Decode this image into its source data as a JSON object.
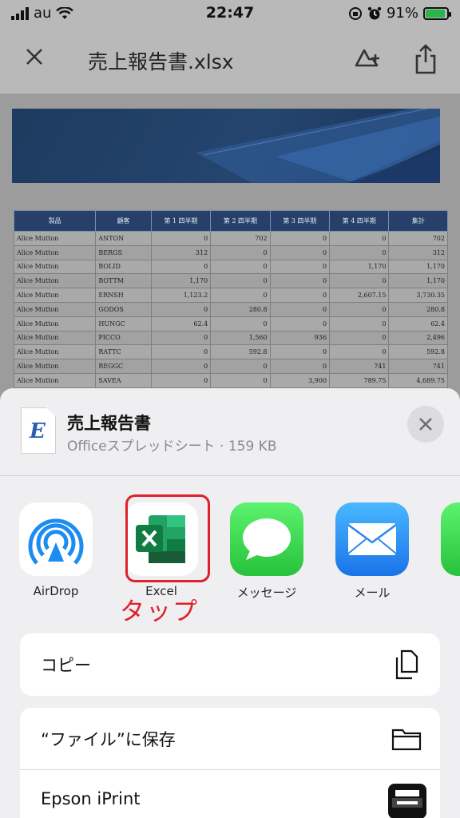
{
  "status": {
    "carrier": "au",
    "time": "22:47",
    "battery": "91%",
    "battery_level": 0.91
  },
  "nav": {
    "title": "売上報告書.xlsx",
    "close_icon": "close-icon",
    "add_cloud_icon": "cloud-add-icon",
    "share_icon": "share-icon"
  },
  "table": {
    "headers": [
      "製品",
      "顧客",
      "第 1 四半期",
      "第 2 四半期",
      "第 3 四半期",
      "第 4 四半期",
      "集計"
    ],
    "rows": [
      [
        "Alice Mutton",
        "ANTON",
        "0",
        "702",
        "0",
        "0",
        "702"
      ],
      [
        "Alice Mutton",
        "BERGS",
        "312",
        "0",
        "0",
        "0",
        "312"
      ],
      [
        "Alice Mutton",
        "BOLID",
        "0",
        "0",
        "0",
        "1,170",
        "1,170"
      ],
      [
        "Alice Mutton",
        "BOTTM",
        "1,170",
        "0",
        "0",
        "0",
        "1,170"
      ],
      [
        "Alice Mutton",
        "ERNSH",
        "1,123.2",
        "0",
        "0",
        "2,607.15",
        "3,730.35"
      ],
      [
        "Alice Mutton",
        "GODOS",
        "0",
        "280.8",
        "0",
        "0",
        "280.8"
      ],
      [
        "Alice Mutton",
        "HUNGC",
        "62.4",
        "0",
        "0",
        "0",
        "62.4"
      ],
      [
        "Alice Mutton",
        "PICCO",
        "0",
        "1,560",
        "936",
        "0",
        "2,496"
      ],
      [
        "Alice Mutton",
        "RATTC",
        "0",
        "592.8",
        "0",
        "0",
        "592.8"
      ],
      [
        "Alice Mutton",
        "REGGC",
        "0",
        "0",
        "0",
        "741",
        "741"
      ],
      [
        "Alice Mutton",
        "SAVEA",
        "0",
        "0",
        "3,900",
        "789.75",
        "4,689.75"
      ]
    ]
  },
  "share": {
    "file_name": "売上報告書",
    "file_meta": "Officeスプレッドシート · 159 KB",
    "file_icon_letter": "E",
    "apps": [
      {
        "label": "AirDrop",
        "icon": "airdrop-icon"
      },
      {
        "label": "Excel",
        "icon": "excel-icon"
      },
      {
        "label": "メッセージ",
        "icon": "messages-icon"
      },
      {
        "label": "メール",
        "icon": "mail-icon"
      }
    ],
    "annotation": "タップ",
    "actions": [
      {
        "label": "コピー",
        "icon": "copy-icon"
      },
      {
        "label": "“ファイル”に保存",
        "icon": "folder-icon"
      },
      {
        "label": "Epson iPrint",
        "icon": "epson-iprint-icon"
      }
    ]
  }
}
